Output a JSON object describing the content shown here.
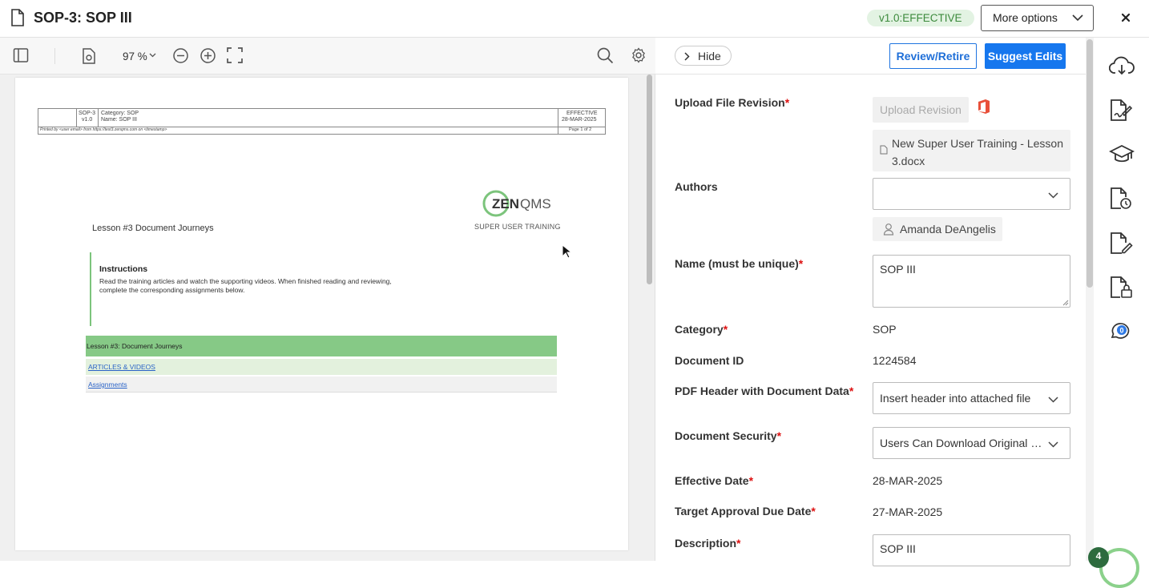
{
  "header": {
    "title": "SOP-3: SOP III",
    "version_badge": "v1.0:EFFECTIVE",
    "more_options": "More options"
  },
  "viewer": {
    "zoom": "97 %",
    "pdf_header": {
      "doc_id": "SOP-3",
      "version": "v1.0",
      "category": "Category: SOP",
      "name": "Name: SOP III",
      "status": "EFFECTIVE",
      "date": "28-MAR-2025",
      "printed_by": "Printed by <user email> from https://test3.zenqms.com on <timestamp>",
      "page": "Page 1 of 2"
    },
    "logo_left": "ZEN",
    "logo_right": "QMS",
    "logo_sub": "SUPER USER TRAINING",
    "lesson_title": "Lesson #3 Document Journeys",
    "instructions_title": "Instructions",
    "instructions_text": "Read the training articles and watch the supporting videos. When finished reading and reviewing, complete the corresponding assignments below.",
    "table_header": "Lesson #3: Document Journeys",
    "table_rows": [
      "ARTICLES & VIDEOS",
      "Assignments"
    ]
  },
  "panel": {
    "hide": "Hide",
    "review_retire": "Review/Retire",
    "suggest_edits": "Suggest Edits",
    "fields": {
      "upload_label": "Upload File Revision",
      "upload_button": "Upload Revision",
      "file_name": "New Super User Training - Lesson 3.docx",
      "authors_label": "Authors",
      "author_name": "Amanda DeAngelis",
      "name_label": "Name (must be unique)",
      "name_value": "SOP III",
      "category_label": "Category",
      "category_value": "SOP",
      "docid_label": "Document ID",
      "docid_value": "1224584",
      "pdfheader_label": "PDF Header with Document Data",
      "pdfheader_value": "Insert header into attached file",
      "security_label": "Document Security",
      "security_value": "Users Can Download Original F...",
      "effective_label": "Effective Date",
      "effective_value": "28-MAR-2025",
      "target_label": "Target Approval Due Date",
      "target_value": "27-MAR-2025",
      "description_label": "Description",
      "description_value": "SOP III"
    },
    "required_mark": "*"
  },
  "rail": {
    "comments_count": "0",
    "notification_count": "4"
  },
  "colors": {
    "primary": "#1677ee",
    "badge_green": "#3c8a3c",
    "doc_green": "#86c986"
  }
}
